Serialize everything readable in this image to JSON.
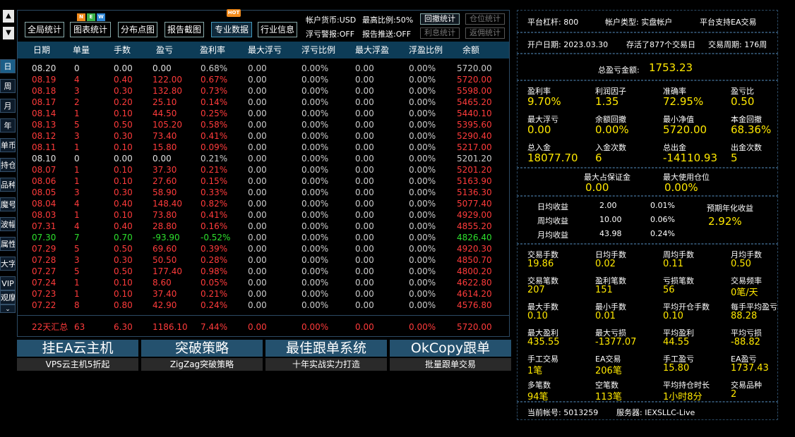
{
  "left_nav": {
    "period_buttons": [
      "日",
      "周",
      "月",
      "年"
    ],
    "side_buttons": [
      "单币",
      "持仓",
      "品种",
      "魔号",
      "波幅",
      "属性",
      "大字",
      "VIP",
      "观摩"
    ]
  },
  "toolbar": {
    "buttons": [
      "全局统计",
      "图表统计",
      "分布点图",
      "报告截图",
      "专业数据",
      "行业信息"
    ],
    "badge_new": [
      "N",
      "E",
      "W"
    ],
    "badge_hot": "HOT",
    "info_currency": "帐户货币:USD",
    "info_ratio": "最高比例:50%",
    "info_floatwarn": "浮亏警报:OFF",
    "info_push": "报告推送:OFF",
    "btn_drawdown": "回撤统计",
    "btn_position": "仓位统计",
    "btn_profit": "利息统计",
    "btn_rebate": "返佣统计"
  },
  "table": {
    "columns": [
      "日期",
      "单量",
      "手数",
      "盈亏",
      "盈利率",
      "最大浮亏",
      "浮亏比例",
      "最大浮盈",
      "浮盈比例",
      "余额"
    ],
    "rows": [
      {
        "date": "08.20",
        "count": "0",
        "lots": "0.00",
        "pnl": "0.00",
        "rate": "0.68%",
        "maxloss": "0.00",
        "lossratio": "0.00%",
        "maxgain": "0.00",
        "gainratio": "0.00%",
        "balance": "5720.00",
        "color": "white"
      },
      {
        "date": "08.19",
        "count": "4",
        "lots": "0.40",
        "pnl": "122.00",
        "rate": "0.67%",
        "maxloss": "0.00",
        "lossratio": "0.00%",
        "maxgain": "0.00",
        "gainratio": "0.00%",
        "balance": "5720.00",
        "color": "red"
      },
      {
        "date": "08.18",
        "count": "3",
        "lots": "0.30",
        "pnl": "132.80",
        "rate": "0.73%",
        "maxloss": "0.00",
        "lossratio": "0.00%",
        "maxgain": "0.00",
        "gainratio": "0.00%",
        "balance": "5598.00",
        "color": "red"
      },
      {
        "date": "08.17",
        "count": "2",
        "lots": "0.20",
        "pnl": "25.10",
        "rate": "0.14%",
        "maxloss": "0.00",
        "lossratio": "0.00%",
        "maxgain": "0.00",
        "gainratio": "0.00%",
        "balance": "5465.20",
        "color": "red"
      },
      {
        "date": "08.14",
        "count": "1",
        "lots": "0.10",
        "pnl": "44.50",
        "rate": "0.25%",
        "maxloss": "0.00",
        "lossratio": "0.00%",
        "maxgain": "0.00",
        "gainratio": "0.00%",
        "balance": "5440.10",
        "color": "red"
      },
      {
        "date": "08.13",
        "count": "5",
        "lots": "0.50",
        "pnl": "105.20",
        "rate": "0.58%",
        "maxloss": "0.00",
        "lossratio": "0.00%",
        "maxgain": "0.00",
        "gainratio": "0.00%",
        "balance": "5395.60",
        "color": "red"
      },
      {
        "date": "08.12",
        "count": "3",
        "lots": "0.30",
        "pnl": "73.40",
        "rate": "0.41%",
        "maxloss": "0.00",
        "lossratio": "0.00%",
        "maxgain": "0.00",
        "gainratio": "0.00%",
        "balance": "5290.40",
        "color": "red"
      },
      {
        "date": "08.11",
        "count": "1",
        "lots": "0.10",
        "pnl": "15.80",
        "rate": "0.09%",
        "maxloss": "0.00",
        "lossratio": "0.00%",
        "maxgain": "0.00",
        "gainratio": "0.00%",
        "balance": "5217.00",
        "color": "red"
      },
      {
        "date": "08.10",
        "count": "0",
        "lots": "0.00",
        "pnl": "0.00",
        "rate": "0.21%",
        "maxloss": "0.00",
        "lossratio": "0.00%",
        "maxgain": "0.00",
        "gainratio": "0.00%",
        "balance": "5201.20",
        "color": "white"
      },
      {
        "date": "08.07",
        "count": "1",
        "lots": "0.10",
        "pnl": "37.30",
        "rate": "0.21%",
        "maxloss": "0.00",
        "lossratio": "0.00%",
        "maxgain": "0.00",
        "gainratio": "0.00%",
        "balance": "5201.20",
        "color": "red"
      },
      {
        "date": "08.06",
        "count": "1",
        "lots": "0.10",
        "pnl": "27.60",
        "rate": "0.15%",
        "maxloss": "0.00",
        "lossratio": "0.00%",
        "maxgain": "0.00",
        "gainratio": "0.00%",
        "balance": "5163.90",
        "color": "red"
      },
      {
        "date": "08.05",
        "count": "3",
        "lots": "0.30",
        "pnl": "58.90",
        "rate": "0.33%",
        "maxloss": "0.00",
        "lossratio": "0.00%",
        "maxgain": "0.00",
        "gainratio": "0.00%",
        "balance": "5136.30",
        "color": "red"
      },
      {
        "date": "08.04",
        "count": "4",
        "lots": "0.40",
        "pnl": "148.40",
        "rate": "0.82%",
        "maxloss": "0.00",
        "lossratio": "0.00%",
        "maxgain": "0.00",
        "gainratio": "0.00%",
        "balance": "5077.40",
        "color": "red"
      },
      {
        "date": "08.03",
        "count": "1",
        "lots": "0.10",
        "pnl": "73.80",
        "rate": "0.41%",
        "maxloss": "0.00",
        "lossratio": "0.00%",
        "maxgain": "0.00",
        "gainratio": "0.00%",
        "balance": "4929.00",
        "color": "red"
      },
      {
        "date": "07.31",
        "count": "4",
        "lots": "0.40",
        "pnl": "28.80",
        "rate": "0.16%",
        "maxloss": "0.00",
        "lossratio": "0.00%",
        "maxgain": "0.00",
        "gainratio": "0.00%",
        "balance": "4855.20",
        "color": "red"
      },
      {
        "date": "07.30",
        "count": "7",
        "lots": "0.70",
        "pnl": "-93.90",
        "rate": "-0.52%",
        "maxloss": "0.00",
        "lossratio": "0.00%",
        "maxgain": "0.00",
        "gainratio": "0.00%",
        "balance": "4826.40",
        "color": "green"
      },
      {
        "date": "07.29",
        "count": "5",
        "lots": "0.50",
        "pnl": "69.60",
        "rate": "0.39%",
        "maxloss": "0.00",
        "lossratio": "0.00%",
        "maxgain": "0.00",
        "gainratio": "0.00%",
        "balance": "4920.30",
        "color": "red"
      },
      {
        "date": "07.28",
        "count": "3",
        "lots": "0.30",
        "pnl": "50.50",
        "rate": "0.28%",
        "maxloss": "0.00",
        "lossratio": "0.00%",
        "maxgain": "0.00",
        "gainratio": "0.00%",
        "balance": "4850.70",
        "color": "red"
      },
      {
        "date": "07.27",
        "count": "5",
        "lots": "0.50",
        "pnl": "177.40",
        "rate": "0.98%",
        "maxloss": "0.00",
        "lossratio": "0.00%",
        "maxgain": "0.00",
        "gainratio": "0.00%",
        "balance": "4800.20",
        "color": "red"
      },
      {
        "date": "07.24",
        "count": "1",
        "lots": "0.10",
        "pnl": "8.60",
        "rate": "0.05%",
        "maxloss": "0.00",
        "lossratio": "0.00%",
        "maxgain": "0.00",
        "gainratio": "0.00%",
        "balance": "4622.80",
        "color": "red"
      },
      {
        "date": "07.23",
        "count": "1",
        "lots": "0.10",
        "pnl": "37.40",
        "rate": "0.21%",
        "maxloss": "0.00",
        "lossratio": "0.00%",
        "maxgain": "0.00",
        "gainratio": "0.00%",
        "balance": "4614.20",
        "color": "red"
      },
      {
        "date": "07.22",
        "count": "8",
        "lots": "0.80",
        "pnl": "42.90",
        "rate": "0.24%",
        "maxloss": "0.00",
        "lossratio": "0.00%",
        "maxgain": "0.00",
        "gainratio": "0.00%",
        "balance": "4576.80",
        "color": "red"
      }
    ],
    "summary": {
      "date": "22天汇总",
      "count": "63",
      "lots": "6.30",
      "pnl": "1186.10",
      "rate": "7.44%",
      "maxloss": "0.00",
      "lossratio": "0.00%",
      "maxgain": "0.00",
      "gainratio": "0.00%",
      "balance": "5720.00"
    }
  },
  "banners": [
    {
      "title": "挂EA云主机",
      "sub": "VPS云主机5折起"
    },
    {
      "title": "突破策略",
      "sub": "ZigZag突破策略"
    },
    {
      "title": "最佳跟单系统",
      "sub": "十年实战实力打造"
    },
    {
      "title": "OkCopy跟单",
      "sub": "批量跟单交易"
    }
  ],
  "stats": {
    "leverage": "平台杠杆: 800",
    "acct_type": "帐户类型: 实盘帐户",
    "ea_support": "平台支持EA交易",
    "open_date": "开户日期: 2023.03.30",
    "survived": "存活了877个交易日",
    "cycle": "交易周期: 176周",
    "total_pnl_label": "总盈亏金额:",
    "total_pnl_value": "1753.23",
    "g1": [
      {
        "label": "盈利率",
        "value": "9.70%"
      },
      {
        "label": "利润因子",
        "value": "1.35"
      },
      {
        "label": "准确率",
        "value": "72.95%"
      },
      {
        "label": "盈亏比",
        "value": "0.50"
      },
      {
        "label": "最大浮亏",
        "value": "0.00"
      },
      {
        "label": "余额回撤",
        "value": "0.00%"
      },
      {
        "label": "最小净值",
        "value": "5720.00"
      },
      {
        "label": "本金回撤",
        "value": "68.36%"
      },
      {
        "label": "总入金",
        "value": "18077.70"
      },
      {
        "label": "入金次数",
        "value": "6"
      },
      {
        "label": "总出金",
        "value": "-14110.93"
      },
      {
        "label": "出金次数",
        "value": "5"
      }
    ],
    "max_margin_label": "最大占保证金",
    "max_margin_value": "0.00",
    "max_pos_label": "最大使用仓位",
    "max_pos_value": "0.00%",
    "avg": [
      {
        "label": "日均收益",
        "v1": "2.00",
        "v2": "0.01%"
      },
      {
        "label": "周均收益",
        "v1": "10.00",
        "v2": "0.06%"
      },
      {
        "label": "月均收益",
        "v1": "43.98",
        "v2": "0.24%"
      }
    ],
    "annual_label": "预期年化收益",
    "annual_value": "2.92%",
    "g2": [
      {
        "label": "交易手数",
        "value": "19.86"
      },
      {
        "label": "日均手数",
        "value": "0.02"
      },
      {
        "label": "周均手数",
        "value": "0.11"
      },
      {
        "label": "月均手数",
        "value": "0.50"
      },
      {
        "label": "交易笔数",
        "value": "207"
      },
      {
        "label": "盈利笔数",
        "value": "151"
      },
      {
        "label": "亏损笔数",
        "value": "56"
      },
      {
        "label": "交易频率",
        "value": "0笔/天"
      },
      {
        "label": "最大手数",
        "value": "0.10"
      },
      {
        "label": "最小手数",
        "value": "0.01"
      },
      {
        "label": "平均开仓手数",
        "value": "0.10"
      },
      {
        "label": "每手平均盈亏",
        "value": "88.28"
      },
      {
        "label": "最大盈利",
        "value": "435.55"
      },
      {
        "label": "最大亏损",
        "value": "-1377.07"
      },
      {
        "label": "平均盈利",
        "value": "44.55"
      },
      {
        "label": "平均亏损",
        "value": "-88.82"
      },
      {
        "label": "手工交易",
        "value": "1笔"
      },
      {
        "label": "EA交易",
        "value": "206笔"
      },
      {
        "label": "手工盈亏",
        "value": "15.80"
      },
      {
        "label": "EA盈亏",
        "value": "1737.43"
      },
      {
        "label": "多笔数",
        "value": "94笔"
      },
      {
        "label": "空笔数",
        "value": "113笔"
      },
      {
        "label": "平均持仓时长",
        "value": "1小时8分"
      },
      {
        "label": "交易品种",
        "value": "2"
      }
    ],
    "account_no": "当前帐号: 5013259",
    "server": "服务器: IEXSLLC-Live"
  },
  "colors": {
    "red": "#ff3b3b",
    "green": "#2de02d",
    "yellow": "#ffe800",
    "header_bg": "#0d3c57",
    "banner_bg": "#24516e"
  }
}
